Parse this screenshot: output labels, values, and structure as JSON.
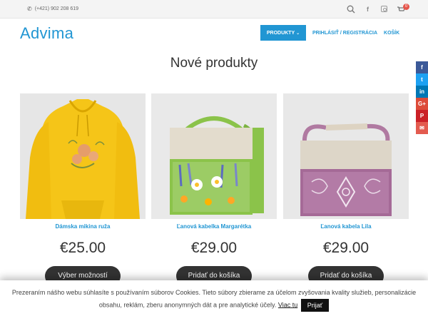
{
  "topbar": {
    "phone": "(+421) 902 208 619",
    "cart_count": "0"
  },
  "header": {
    "logo": "Advima",
    "nav": [
      {
        "label": "PRODUKTY",
        "active": true
      },
      {
        "label": "PRIHLÁSIŤ / REGISTRÁCIA"
      },
      {
        "label": "KOŠÍK"
      }
    ]
  },
  "main": {
    "title": "Nové produkty",
    "products": [
      {
        "name": "Dámska mikina ruža",
        "price": "€25.00",
        "button": "Výber možností"
      },
      {
        "name": "Ľanová kabelka Margarétka",
        "price": "€29.00",
        "button": "Pridať do košíka"
      },
      {
        "name": "Ľanová kabela Lila",
        "price": "€29.00",
        "button": "Pridať do košíka"
      }
    ]
  },
  "share": [
    {
      "icon": "facebook-icon",
      "glyph": "f",
      "color": "#3b5998"
    },
    {
      "icon": "twitter-icon",
      "glyph": "t",
      "color": "#1da1f2"
    },
    {
      "icon": "linkedin-icon",
      "glyph": "in",
      "color": "#0077b5"
    },
    {
      "icon": "google-plus-icon",
      "glyph": "G+",
      "color": "#dd4b39"
    },
    {
      "icon": "pinterest-icon",
      "glyph": "P",
      "color": "#cb2027"
    },
    {
      "icon": "email-icon",
      "glyph": "✉",
      "color": "#e35b4f"
    }
  ],
  "cookie": {
    "text": "Prezeraním nášho webu súhlasíte s používaním súborov Cookies. Tieto súbory zbierame za účelom zvyšovania kvality služieb, personalizácie obsahu, reklám, zberu anonymných dát a pre analytické účely.",
    "more_link": "Viac tu",
    "accept_label": "Prijať"
  }
}
